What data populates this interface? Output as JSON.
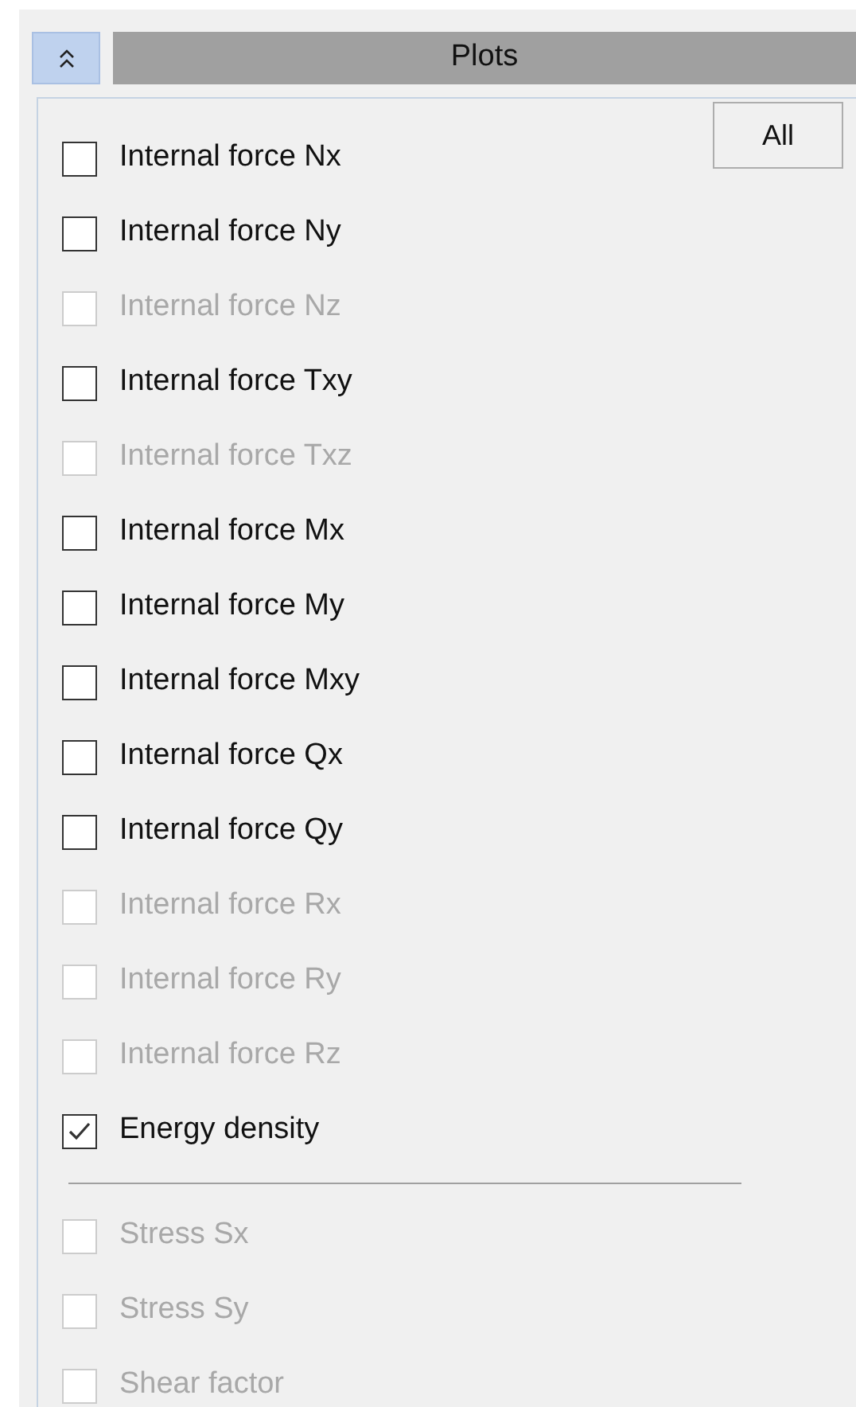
{
  "section": {
    "title": "Plots",
    "expanded": true
  },
  "all_button": "All",
  "items": [
    {
      "kind": "checkbox",
      "label": "Internal force Nx",
      "checked": false,
      "disabled": false
    },
    {
      "kind": "checkbox",
      "label": "Internal force Ny",
      "checked": false,
      "disabled": false
    },
    {
      "kind": "checkbox",
      "label": "Internal force Nz",
      "checked": false,
      "disabled": true
    },
    {
      "kind": "checkbox",
      "label": "Internal force Txy",
      "checked": false,
      "disabled": false
    },
    {
      "kind": "checkbox",
      "label": "Internal force Txz",
      "checked": false,
      "disabled": true
    },
    {
      "kind": "checkbox",
      "label": "Internal force Mx",
      "checked": false,
      "disabled": false
    },
    {
      "kind": "checkbox",
      "label": "Internal force My",
      "checked": false,
      "disabled": false
    },
    {
      "kind": "checkbox",
      "label": "Internal force Mxy",
      "checked": false,
      "disabled": false
    },
    {
      "kind": "checkbox",
      "label": "Internal force Qx",
      "checked": false,
      "disabled": false
    },
    {
      "kind": "checkbox",
      "label": "Internal force Qy",
      "checked": false,
      "disabled": false
    },
    {
      "kind": "checkbox",
      "label": "Internal force Rx",
      "checked": false,
      "disabled": true
    },
    {
      "kind": "checkbox",
      "label": "Internal force Ry",
      "checked": false,
      "disabled": true
    },
    {
      "kind": "checkbox",
      "label": "Internal force Rz",
      "checked": false,
      "disabled": true
    },
    {
      "kind": "checkbox",
      "label": "Energy density",
      "checked": true,
      "disabled": false
    },
    {
      "kind": "separator"
    },
    {
      "kind": "checkbox",
      "label": "Stress Sx",
      "checked": false,
      "disabled": true
    },
    {
      "kind": "checkbox",
      "label": "Stress Sy",
      "checked": false,
      "disabled": true
    },
    {
      "kind": "checkbox",
      "label": "Shear factor",
      "checked": false,
      "disabled": true
    }
  ]
}
